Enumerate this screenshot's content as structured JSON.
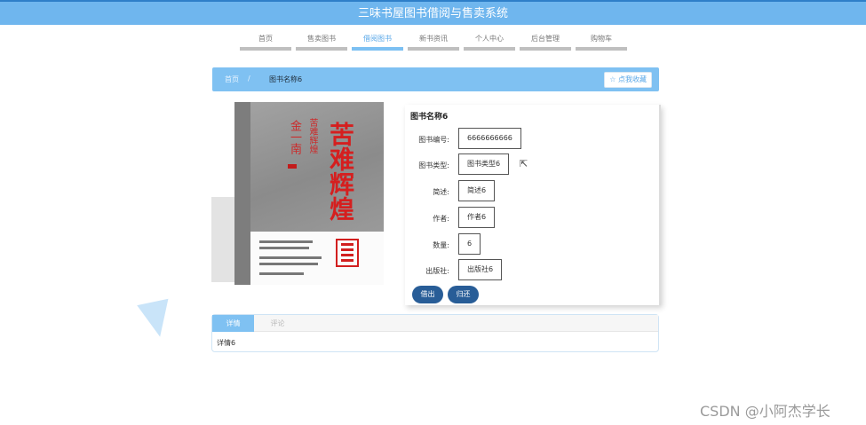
{
  "header": {
    "title": "三味书屋图书借阅与售卖系统"
  },
  "nav": {
    "items": [
      {
        "label": "首页",
        "active": false
      },
      {
        "label": "售卖图书",
        "active": false
      },
      {
        "label": "借阅图书",
        "active": true
      },
      {
        "label": "新书资讯",
        "active": false
      },
      {
        "label": "个人中心",
        "active": false
      },
      {
        "label": "后台管理",
        "active": false
      },
      {
        "label": "购物车",
        "active": false
      }
    ]
  },
  "breadcrumb": {
    "home": "首页",
    "separator": "/",
    "current": "图书名称6",
    "favorite_label": "☆ 点我收藏"
  },
  "cover": {
    "subtitle": "苦难辉煌",
    "author": "金一南",
    "title": "苦难辉煌"
  },
  "book": {
    "title": "图书名称6",
    "fields": [
      {
        "label": "图书编号:",
        "value": "6666666666"
      },
      {
        "label": "图书类型:",
        "value": "图书类型6"
      },
      {
        "label": "简述:",
        "value": "简述6"
      },
      {
        "label": "作者:",
        "value": "作者6"
      },
      {
        "label": "数量:",
        "value": "6"
      },
      {
        "label": "出版社:",
        "value": "出版社6"
      }
    ],
    "borrow_label": "借出",
    "return_label": "归还"
  },
  "tabs": {
    "items": [
      {
        "label": "详情",
        "active": true
      },
      {
        "label": "评论",
        "active": false
      }
    ],
    "content": "详情6"
  },
  "watermark": "CSDN @小阿杰学长",
  "colors": {
    "accent": "#7fc1f2",
    "button": "#285d97"
  }
}
